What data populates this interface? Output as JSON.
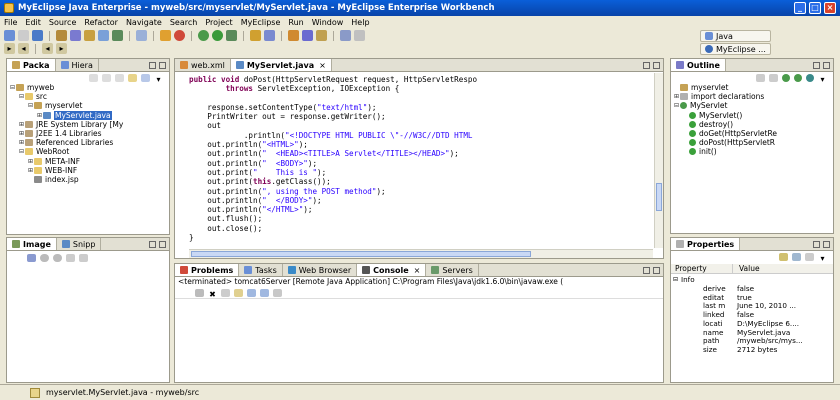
{
  "window": {
    "title": "MyEclipse Java Enterprise - myweb/src/myservlet/MyServlet.java - MyEclipse Enterprise Workbench"
  },
  "menu": [
    "File",
    "Edit",
    "Source",
    "Refactor",
    "Navigate",
    "Search",
    "Project",
    "MyEclipse",
    "Run",
    "Window",
    "Help"
  ],
  "perspective": {
    "java": "Java",
    "myeclipse": "MyEclipse ..."
  },
  "package_explorer": {
    "tabs": [
      "Packa",
      "Hiera"
    ],
    "tree": [
      {
        "label": "myweb",
        "exp": "⊟",
        "level": 0,
        "icon": "project"
      },
      {
        "label": "src",
        "exp": "⊟",
        "level": 1,
        "icon": "folder"
      },
      {
        "label": "myservlet",
        "exp": "⊟",
        "level": 2,
        "icon": "package"
      },
      {
        "label": "MyServlet.java",
        "exp": "⊞",
        "level": 3,
        "icon": "java",
        "selected": true
      },
      {
        "label": "JRE System Library [My",
        "exp": "⊞",
        "level": 1,
        "icon": "lib"
      },
      {
        "label": "J2EE 1.4 Libraries",
        "exp": "⊞",
        "level": 1,
        "icon": "lib"
      },
      {
        "label": "Referenced Libraries",
        "exp": "⊞",
        "level": 1,
        "icon": "lib"
      },
      {
        "label": "WebRoot",
        "exp": "⊟",
        "level": 1,
        "icon": "folder"
      },
      {
        "label": "META-INF",
        "exp": "⊞",
        "level": 2,
        "icon": "folder"
      },
      {
        "label": "WEB-INF",
        "exp": "⊞",
        "level": 2,
        "icon": "folder"
      },
      {
        "label": "index.jsp",
        "exp": "",
        "level": 2,
        "icon": "jsp"
      }
    ]
  },
  "image_view": {
    "tabs": [
      "Image",
      "Snipp"
    ]
  },
  "editor": {
    "tabs": [
      "web.xml",
      "MyServlet.java"
    ],
    "lines": [
      [
        [
          "k",
          "public void "
        ],
        [
          "t",
          "doPost(HttpServletRequest request, HttpServletRespo"
        ]
      ],
      [
        [
          "t",
          "        "
        ],
        [
          "k",
          "throws "
        ],
        [
          "t",
          "ServletException, IOException {"
        ]
      ],
      [
        [
          "t",
          ""
        ]
      ],
      [
        [
          "t",
          "    response.setContentType("
        ],
        [
          "s",
          "\"text/html\""
        ],
        [
          "t",
          ");"
        ]
      ],
      [
        [
          "t",
          "    PrintWriter out = response.getWriter();"
        ]
      ],
      [
        [
          "t",
          "    out"
        ]
      ],
      [
        [
          "t",
          "            .println("
        ],
        [
          "s",
          "\"<!DOCTYPE HTML PUBLIC \\\"-//W3C//DTD HTML"
        ]
      ],
      [
        [
          "t",
          "    out.println("
        ],
        [
          "s",
          "\"<HTML>\""
        ],
        [
          "t",
          ");"
        ]
      ],
      [
        [
          "t",
          "    out.println("
        ],
        [
          "s",
          "\"  <HEAD><TITLE>A Servlet</TITLE></HEAD>\""
        ],
        [
          "t",
          ");"
        ]
      ],
      [
        [
          "t",
          "    out.println("
        ],
        [
          "s",
          "\"  <BODY>\""
        ],
        [
          "t",
          ");"
        ]
      ],
      [
        [
          "t",
          "    out.print("
        ],
        [
          "s",
          "\"    This is \""
        ],
        [
          "t",
          ");"
        ]
      ],
      [
        [
          "t",
          "    out.print("
        ],
        [
          "k",
          "this"
        ],
        [
          "t",
          ".getClass());"
        ]
      ],
      [
        [
          "t",
          "    out.println("
        ],
        [
          "s",
          "\", using the POST method\""
        ],
        [
          "t",
          ");"
        ]
      ],
      [
        [
          "t",
          "    out.println("
        ],
        [
          "s",
          "\"  </BODY>\""
        ],
        [
          "t",
          ");"
        ]
      ],
      [
        [
          "t",
          "    out.println("
        ],
        [
          "s",
          "\"</HTML>\""
        ],
        [
          "t",
          ");"
        ]
      ],
      [
        [
          "t",
          "    out.flush();"
        ]
      ],
      [
        [
          "t",
          "    out.close();"
        ]
      ],
      [
        [
          "t",
          "}"
        ]
      ]
    ]
  },
  "outline": {
    "title": "Outline",
    "tree": [
      {
        "label": "myservlet",
        "exp": "",
        "level": 0,
        "icon": "package"
      },
      {
        "label": "import declarations",
        "exp": "⊞",
        "level": 0,
        "icon": "import"
      },
      {
        "label": "MyServlet",
        "exp": "⊟",
        "level": 0,
        "icon": "class"
      },
      {
        "label": "MyServlet()",
        "exp": "",
        "level": 1,
        "icon": "method"
      },
      {
        "label": "destroy()",
        "exp": "",
        "level": 1,
        "icon": "method"
      },
      {
        "label": "doGet(HttpServletRe",
        "exp": "",
        "level": 1,
        "icon": "method"
      },
      {
        "label": "doPost(HttpServletR",
        "exp": "",
        "level": 1,
        "icon": "method"
      },
      {
        "label": "init()",
        "exp": "",
        "level": 1,
        "icon": "method"
      }
    ]
  },
  "properties": {
    "title": "Properties",
    "col_property": "Property",
    "col_value": "Value",
    "group": "Info",
    "rows": [
      {
        "k": "derive",
        "v": "false"
      },
      {
        "k": "editat",
        "v": "true"
      },
      {
        "k": "last m",
        "v": "June 10, 2010 ..."
      },
      {
        "k": "linked",
        "v": "false"
      },
      {
        "k": "locati",
        "v": "D:\\MyEclipse 6...."
      },
      {
        "k": "name",
        "v": "MyServlet.java"
      },
      {
        "k": "path",
        "v": "/myweb/src/mys..."
      },
      {
        "k": "size",
        "v": "2712  bytes"
      }
    ]
  },
  "console_view": {
    "tabs": [
      "Problems",
      "Tasks",
      "Web Browser",
      "Console",
      "Servers"
    ],
    "header": "<terminated> tomcat6Server [Remote Java Application] C:\\Program Files\\Java\\jdk1.6.0\\bin\\javaw.exe ("
  },
  "status": {
    "text": "myservlet.MyServlet.java - myweb/src"
  },
  "colors": {
    "title": "#0a5fd9",
    "keyword": "#7f0055",
    "string": "#2a00ff",
    "selection": "#316ac5"
  }
}
